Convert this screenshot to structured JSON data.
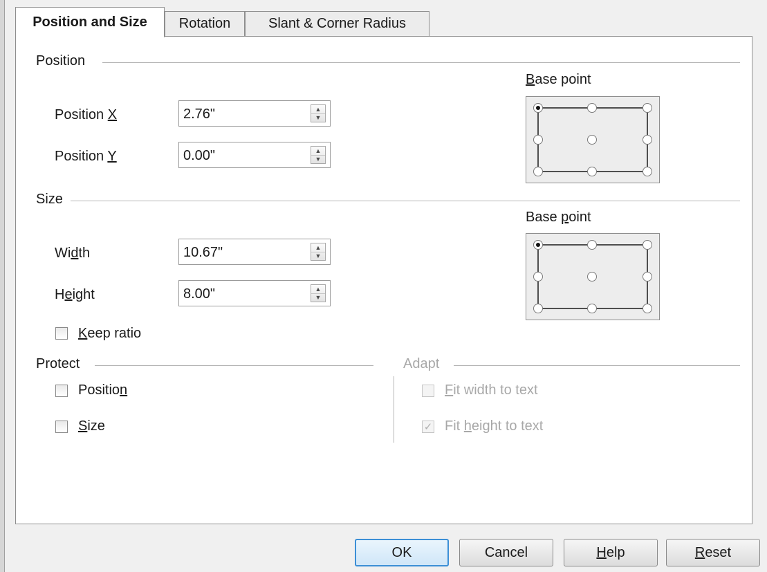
{
  "tabs": [
    {
      "label": "Position and Size"
    },
    {
      "label": "Rotation"
    },
    {
      "label": "Slant & Corner Radius"
    }
  ],
  "position": {
    "title": "Position",
    "x_label": "Position ",
    "x_key": "X",
    "x_value": "2.76\"",
    "y_label": "Position ",
    "y_key": "Y",
    "y_value": "0.00\"",
    "base_point_pre": "",
    "base_point_key": "B",
    "base_point_post": "ase point"
  },
  "size": {
    "title": "Size",
    "width_pre": "Wi",
    "width_key": "d",
    "width_post": "th",
    "width_value": "10.67\"",
    "height_pre": "H",
    "height_key": "e",
    "height_post": "ight",
    "height_value": "8.00\"",
    "keep_ratio_key": "K",
    "keep_ratio_post": "eep ratio",
    "base_point_pre": "Base ",
    "base_point_key": "p",
    "base_point_post": "oint"
  },
  "protect": {
    "title": "Protect",
    "position_pre": "Positio",
    "position_key": "n",
    "size_key": "S",
    "size_post": "ize"
  },
  "adapt": {
    "title": "Adapt",
    "fit_width_key": "F",
    "fit_width_post": "it width to text",
    "fit_height_pre": "Fit ",
    "fit_height_key": "h",
    "fit_height_post": "eight to text",
    "check_glyph": "✓"
  },
  "buttons": {
    "ok": "OK",
    "cancel": "Cancel",
    "help_key": "H",
    "help_post": "elp",
    "reset_key": "R",
    "reset_post": "eset"
  },
  "spin_up_glyph": "▲",
  "spin_down_glyph": "▼",
  "colors": {
    "accent": "#3c8fd6",
    "disabled_text": "#a8a8a8"
  }
}
